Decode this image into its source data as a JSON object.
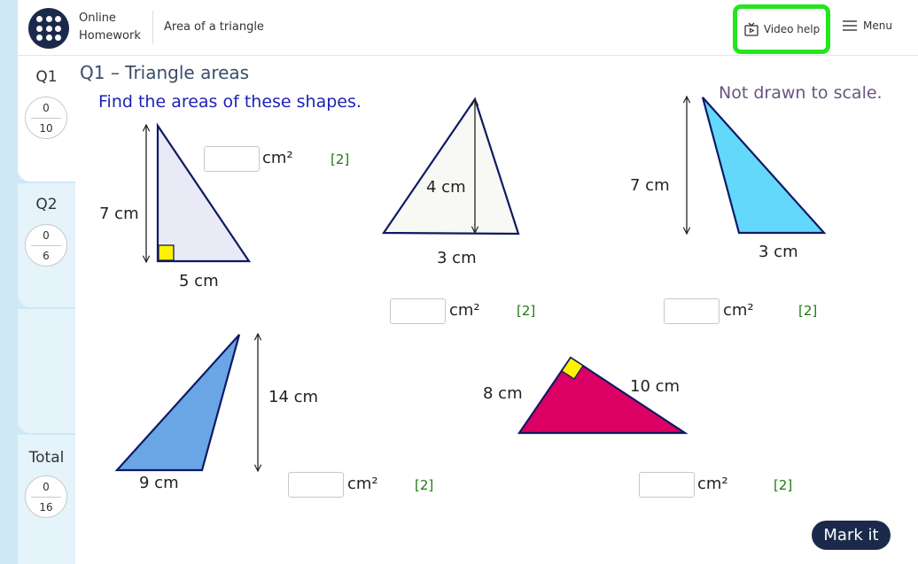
{
  "header": {
    "brand_line1": "Online",
    "brand_line2": "Homework",
    "page_title": "Area of a triangle",
    "video_help_label": "Video help",
    "menu_label": "Menu"
  },
  "sidebar": {
    "q1": {
      "label": "Q1",
      "score": "0",
      "max": "10"
    },
    "q2": {
      "label": "Q2",
      "score": "0",
      "max": "6"
    },
    "total": {
      "label": "Total",
      "score": "0",
      "max": "16"
    }
  },
  "question": {
    "title": "Q1 – Triangle areas",
    "instruction": "Find the areas of these shapes.",
    "scale_note": "Not drawn to scale.",
    "unit": "cm²",
    "marks": "[2]",
    "shapes": {
      "a": {
        "height": "7 cm",
        "base": "5 cm"
      },
      "b": {
        "height": "4 cm",
        "base": "3 cm"
      },
      "c": {
        "height": "7 cm",
        "base": "3 cm"
      },
      "d": {
        "height": "14 cm",
        "base": "9 cm"
      },
      "e": {
        "side1": "8 cm",
        "side2": "10 cm"
      }
    }
  },
  "actions": {
    "mark_it": "Mark it"
  },
  "colors": {
    "outline": "#0e1a63",
    "triangle_a_fill": "#eaeaf6",
    "triangle_b_fill": "#f8f8f4",
    "triangle_c_fill": "#63d8fb",
    "triangle_d_fill": "#6aa6e6",
    "triangle_e_fill": "#dc0065",
    "right_angle": "#fff200",
    "highlight": "#22e61e"
  }
}
